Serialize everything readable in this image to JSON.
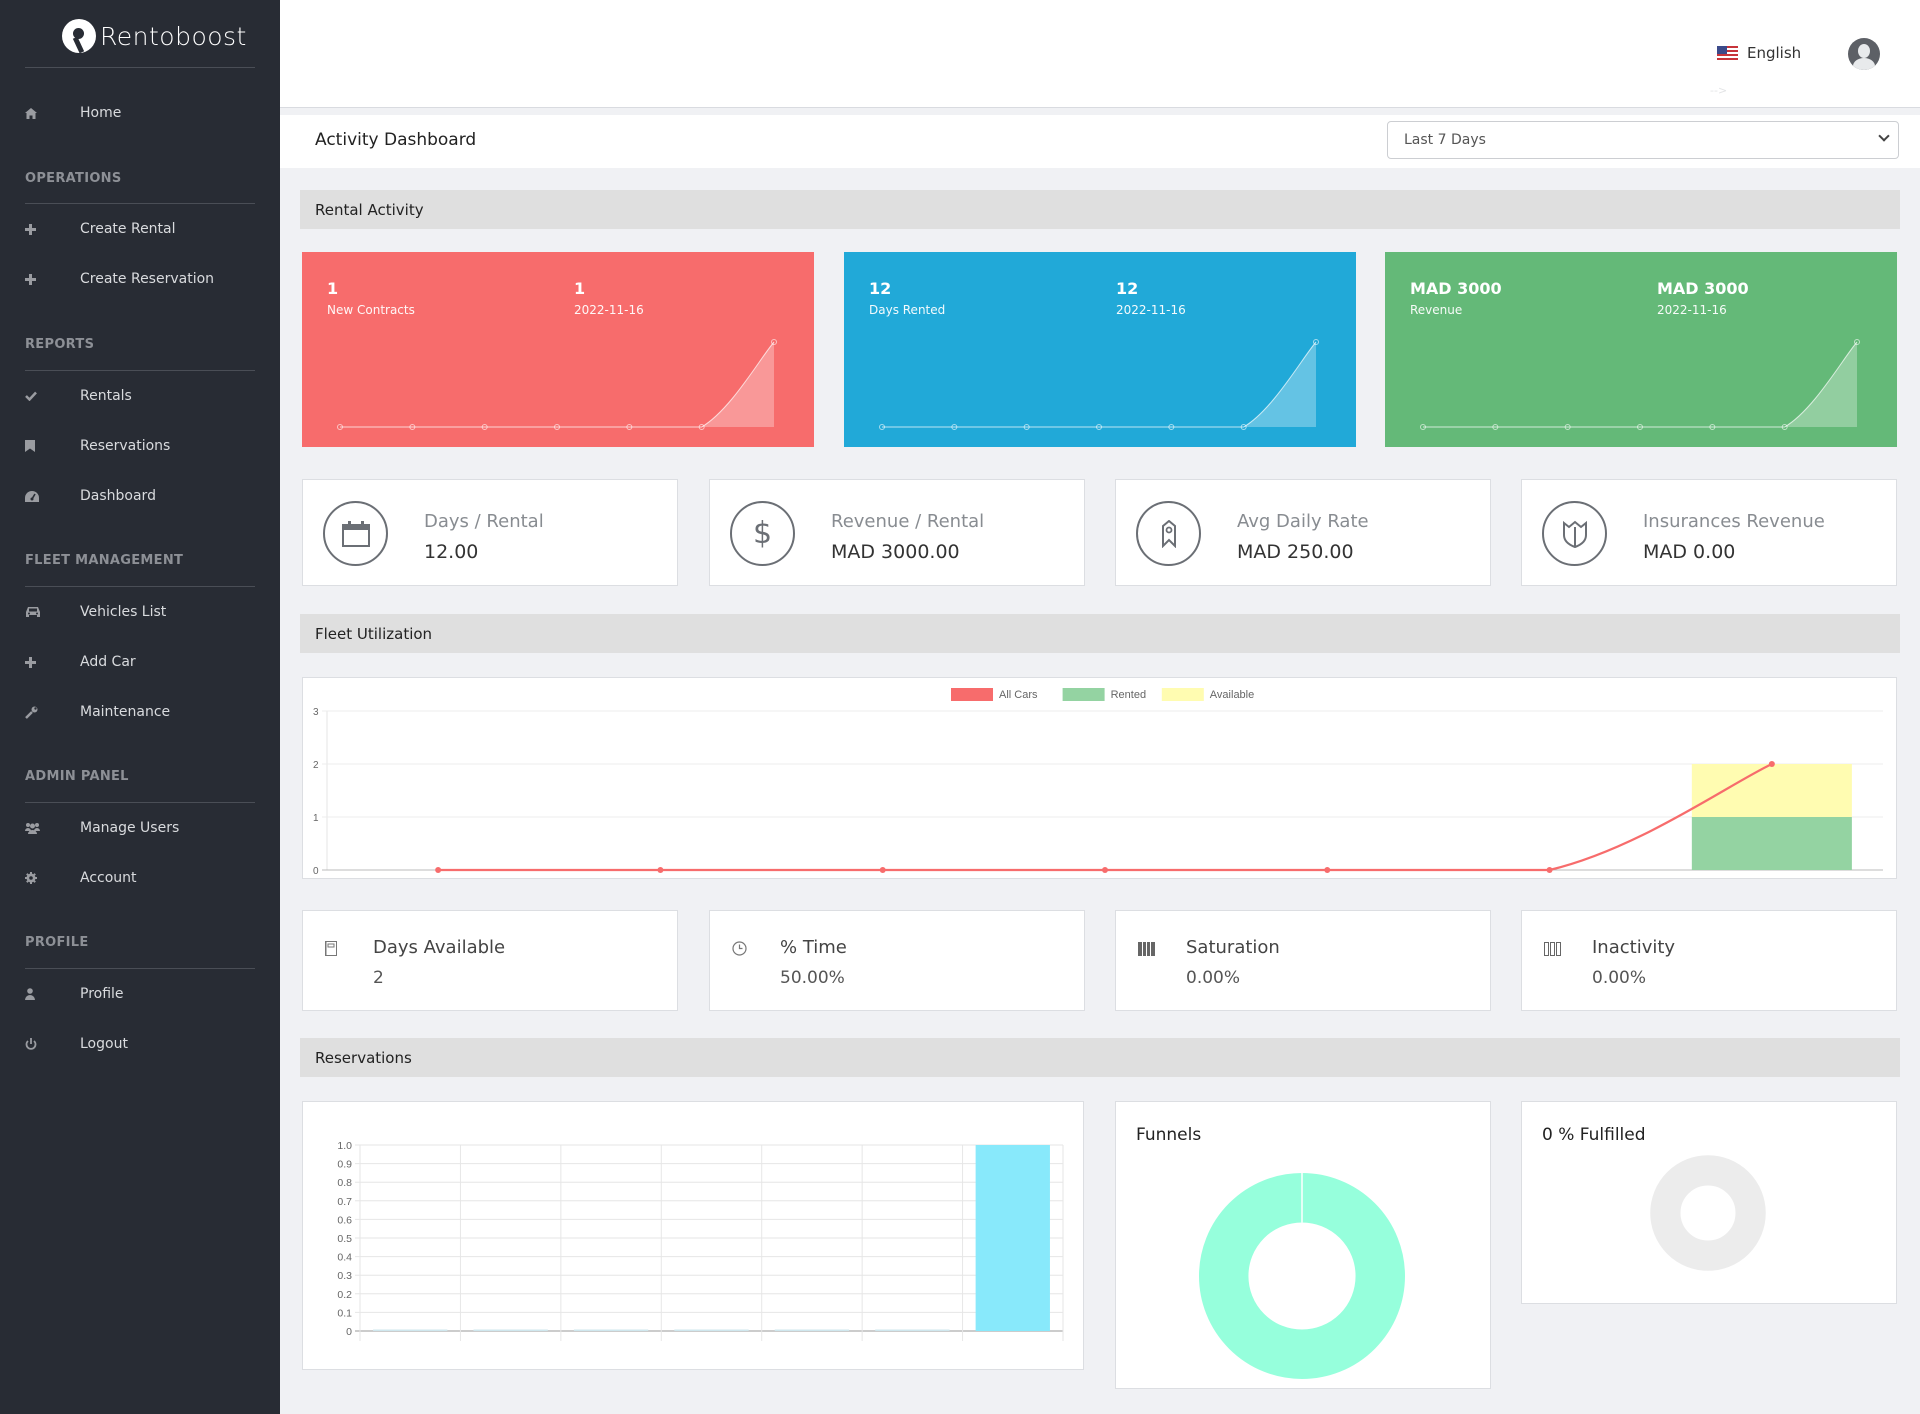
{
  "brand": {
    "name": "Rentoboost"
  },
  "sidebar": {
    "home": {
      "label": "Home",
      "icon": "home-icon"
    },
    "sections": [
      {
        "heading": "OPERATIONS",
        "items": [
          {
            "label": "Create Rental",
            "icon": "plus-icon"
          },
          {
            "label": "Create Reservation",
            "icon": "plus-icon"
          }
        ]
      },
      {
        "heading": "REPORTS",
        "items": [
          {
            "label": "Rentals",
            "icon": "check-icon"
          },
          {
            "label": "Reservations",
            "icon": "bookmark-icon"
          },
          {
            "label": "Dashboard",
            "icon": "dashboard-gauge-icon"
          }
        ]
      },
      {
        "heading": "FLEET MANAGEMENT",
        "items": [
          {
            "label": "Vehicles List",
            "icon": "car-icon"
          },
          {
            "label": "Add Car",
            "icon": "plus-icon"
          },
          {
            "label": "Maintenance",
            "icon": "wrench-icon"
          }
        ]
      },
      {
        "heading": "ADMIN PANEL",
        "items": [
          {
            "label": "Manage Users",
            "icon": "users-icon"
          },
          {
            "label": "Account",
            "icon": "gear-icon"
          }
        ]
      },
      {
        "heading": "PROFILE",
        "items": [
          {
            "label": "Profile",
            "icon": "user-icon"
          },
          {
            "label": "Logout",
            "icon": "power-icon"
          }
        ]
      }
    ]
  },
  "header": {
    "language": "English",
    "language_flag": "us-flag-icon",
    "artifact": "-->"
  },
  "titlebar": {
    "title": "Activity Dashboard",
    "range_selected": "Last 7 Days"
  },
  "sections": {
    "rental_activity": "Rental Activity",
    "fleet_utilization": "Fleet Utilization",
    "reservations": "Reservations"
  },
  "colors": {
    "red_card": "#f76c6c",
    "blue_card": "#21a9d8",
    "green_card": "#64b978",
    "sidebar_bg": "#282c34",
    "all_cars": "#f76c6c",
    "rented": "#94d3a2",
    "available": "#fffcb1",
    "reservation_bar": "#88e9fb",
    "funnel": "#96ffdc",
    "empty_donut": "#ececec"
  },
  "activity_cards": [
    {
      "value": "1",
      "label": "New Contracts",
      "latest_value": "1",
      "latest_date": "2022-11-16",
      "color": "#f76c6c",
      "spark": [
        0,
        0,
        0,
        0,
        0,
        0,
        1
      ]
    },
    {
      "value": "12",
      "label": "Days Rented",
      "latest_value": "12",
      "latest_date": "2022-11-16",
      "color": "#21a9d8",
      "spark": [
        0,
        0,
        0,
        0,
        0,
        0,
        12
      ]
    },
    {
      "value": "MAD 3000",
      "label": "Revenue",
      "latest_value": "MAD 3000",
      "latest_date": "2022-11-16",
      "color": "#64b978",
      "spark": [
        0,
        0,
        0,
        0,
        0,
        0,
        3000
      ]
    }
  ],
  "kpis": [
    {
      "label": "Days / Rental",
      "value": "12.00",
      "icon": "calendar-icon"
    },
    {
      "label": "Revenue / Rental",
      "value": "MAD 3000.00",
      "icon": "dollar-icon"
    },
    {
      "label": "Avg Daily Rate",
      "value": "MAD 250.00",
      "icon": "ribbon-badge-icon"
    },
    {
      "label": "Insurances Revenue",
      "value": "MAD 0.00",
      "icon": "shield-icon"
    }
  ],
  "fleet_stats": [
    {
      "label": "Days Available",
      "value": "2",
      "icon": "notebook-icon"
    },
    {
      "label": "% Time",
      "value": "50.00%",
      "icon": "clock-icon"
    },
    {
      "label": "Saturation",
      "value": "0.00%",
      "icon": "bars-filled-icon"
    },
    {
      "label": "Inactivity",
      "value": "0.00%",
      "icon": "bars-outline-icon"
    }
  ],
  "reservation_cards": {
    "funnels_title": "Funnels",
    "fulfilled_title": "0 % Fulfilled"
  },
  "chart_data": [
    {
      "id": "fleet_utilization",
      "type": "bar",
      "title": "",
      "categories": [
        "",
        "",
        "",
        "",
        "",
        "",
        ""
      ],
      "series": [
        {
          "name": "All Cars",
          "kind": "line",
          "color": "#f76c6c",
          "values": [
            0,
            0,
            0,
            0,
            0,
            0,
            2
          ]
        },
        {
          "name": "Rented",
          "kind": "stacked-bar",
          "color": "#94d3a2",
          "values": [
            0,
            0,
            0,
            0,
            0,
            0,
            1
          ]
        },
        {
          "name": "Available",
          "kind": "stacked-bar",
          "color": "#fffcb1",
          "values": [
            0,
            0,
            0,
            0,
            0,
            0,
            1
          ]
        }
      ],
      "yticks": [
        0,
        1,
        2,
        3
      ],
      "ylim": [
        0,
        3
      ],
      "xlabel": "",
      "ylabel": "",
      "legend": "top-center",
      "grid": true
    },
    {
      "id": "reservations_bar",
      "type": "bar",
      "title": "",
      "categories": [
        "",
        "",
        "",
        "",
        "",
        "",
        ""
      ],
      "values": [
        0,
        0,
        0,
        0,
        0,
        0,
        1
      ],
      "color": "#88e9fb",
      "yticks": [
        "0",
        "0.1",
        "0.2",
        "0.3",
        "0.4",
        "0.5",
        "0.6",
        "0.7",
        "0.8",
        "0.9",
        "1.0"
      ],
      "ylim": [
        0,
        1
      ],
      "xlabel": "",
      "ylabel": "",
      "grid": true
    },
    {
      "id": "funnels",
      "type": "pie",
      "title": "Funnels",
      "labels": [
        ""
      ],
      "values": [
        1
      ],
      "colors": [
        "#96ffdc"
      ],
      "donut": true
    },
    {
      "id": "fulfilled",
      "type": "pie",
      "title": "0 % Fulfilled",
      "labels": [
        ""
      ],
      "values": [
        0
      ],
      "colors": [
        "#ececec"
      ],
      "donut": true,
      "empty": true
    }
  ]
}
